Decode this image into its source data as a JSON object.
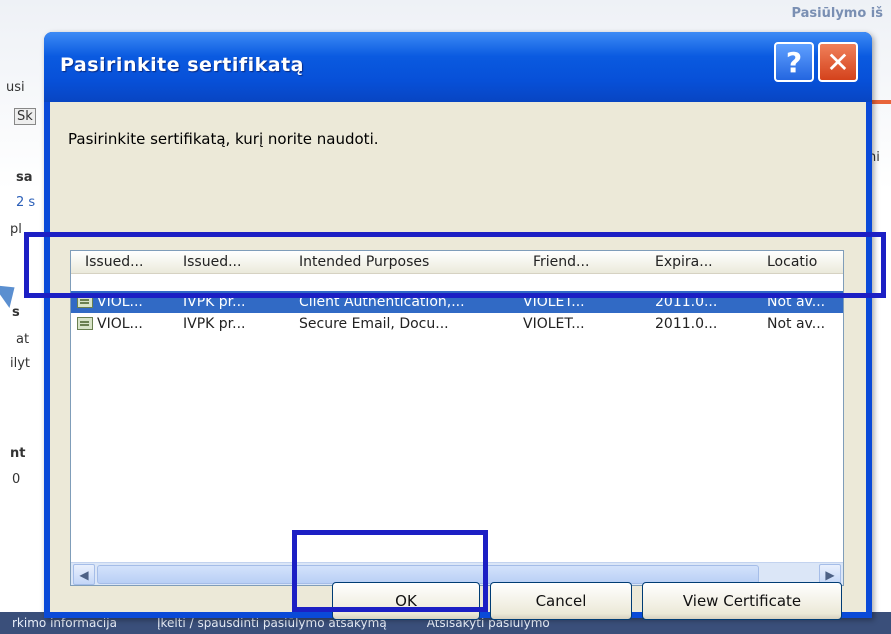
{
  "background": {
    "title_right": "Pasiūlymo iš",
    "left_fragments": [
      "usi",
      "Sk",
      "sa",
      "2 s",
      "pl",
      "s",
      "at",
      "ilyt",
      "nt",
      "0"
    ],
    "right_fragment": "ni",
    "bottom_tabs": [
      "rkimo informacija",
      "Įkelti / spausdinti pasiūlymo atsakymą",
      "Atsisakyti pasiūlymo"
    ]
  },
  "dialog": {
    "title": "Pasirinkite sertifikatą",
    "help_label": "?",
    "close_label": "✕",
    "prompt": "Pasirinkite sertifikatą, kurį norite naudoti.",
    "columns": [
      "Issued...",
      "Issued...",
      "Intended Purposes",
      "Friend...",
      "Expira...",
      "Locatio"
    ],
    "rows": [
      {
        "issued_to": "VIOL...",
        "issued_by": "IVPK pr...",
        "purposes": "Client Authentication,...",
        "friendly": "VIOLET...",
        "expires": "2011.0...",
        "location": "Not av...",
        "selected": true
      },
      {
        "issued_to": "VIOL...",
        "issued_by": "IVPK pr...",
        "purposes": "Secure Email, Docu...",
        "friendly": "VIOLET...",
        "expires": "2011.0...",
        "location": "Not av...",
        "selected": false
      }
    ],
    "buttons": {
      "ok": "OK",
      "cancel": "Cancel",
      "view": "View Certificate"
    }
  },
  "colors": {
    "titlebar": "#0a5ae0",
    "selection": "#316ac5",
    "highlight_box": "#1c1fc4",
    "dialog_face": "#ece9d8"
  }
}
